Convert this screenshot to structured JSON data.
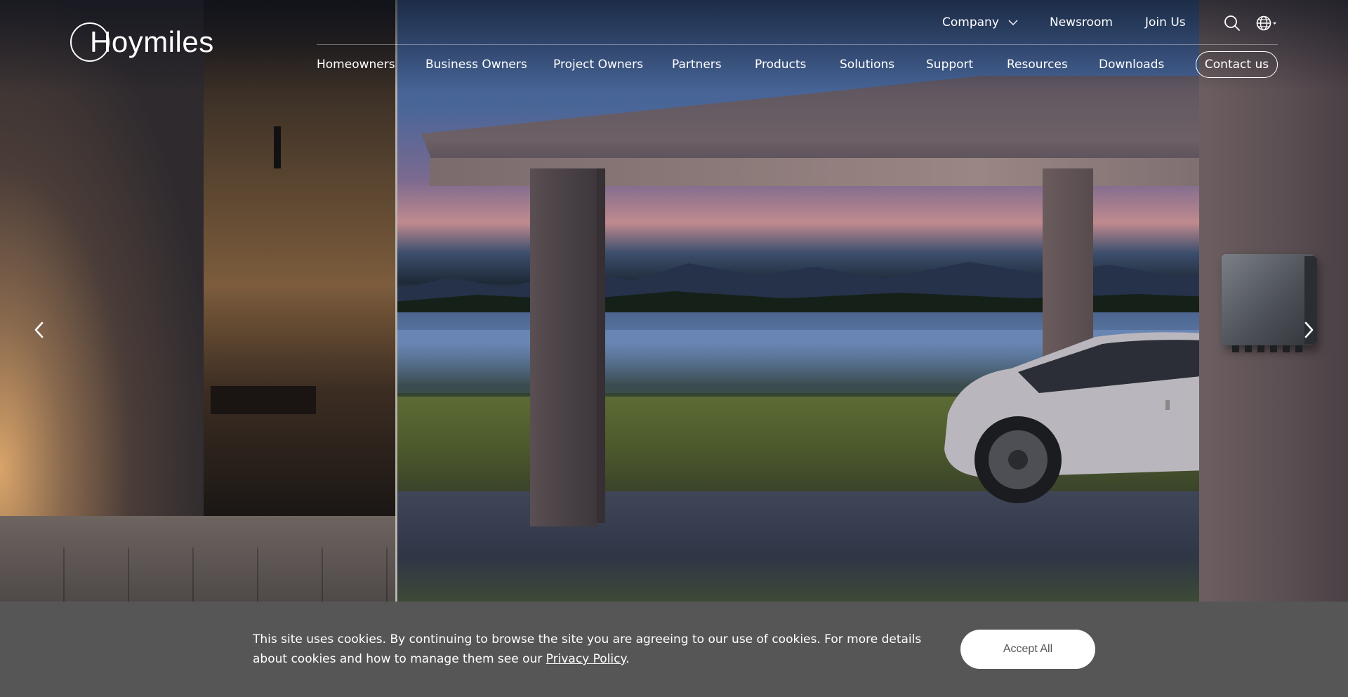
{
  "brand": {
    "name": "Hoymiles"
  },
  "topbar": {
    "company_label": "Company",
    "newsroom_label": "Newsroom",
    "joinus_label": "Join Us"
  },
  "nav": {
    "items": [
      {
        "label": "Homeowners"
      },
      {
        "label": "Business Owners"
      },
      {
        "label": "Project Owners"
      },
      {
        "label": "Partners"
      },
      {
        "label": "Products"
      },
      {
        "label": "Solutions"
      },
      {
        "label": "Support"
      },
      {
        "label": "Resources"
      },
      {
        "label": "Downloads"
      }
    ],
    "contact_label": "Contact us"
  },
  "icons": {
    "search": "search-icon",
    "language": "globe-icon",
    "prev": "chevron-left-icon",
    "next": "chevron-right-icon"
  },
  "cookie": {
    "text_before": "This site uses cookies. By continuing to browse the site you are agreeing to our use of cookies. For more details about cookies and how to manage them see our ",
    "link_label": "Privacy Policy",
    "text_after": ".",
    "accept_label": "Accept All"
  },
  "colors": {
    "cookie_bg": "#565656",
    "text": "#ffffff"
  }
}
